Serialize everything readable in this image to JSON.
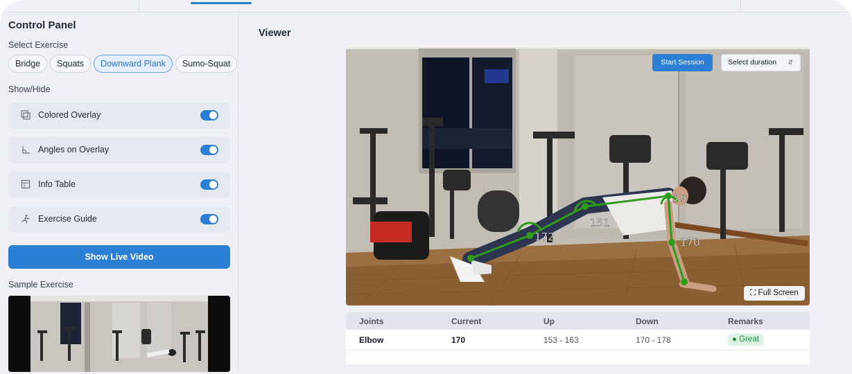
{
  "sidebar": {
    "title": "Control Panel",
    "select_exercise_label": "Select Exercise",
    "exercises": [
      "Bridge",
      "Squats",
      "Downward Plank",
      "Sumo-Squat"
    ],
    "active_exercise": "Downward Plank",
    "show_hide_label": "Show/Hide",
    "toggles": [
      {
        "label": "Colored Overlay",
        "icon": "overlay-icon",
        "on": true
      },
      {
        "label": "Angles on Overlay",
        "icon": "angle-icon",
        "on": true
      },
      {
        "label": "Info Table",
        "icon": "table-icon",
        "on": true
      },
      {
        "label": "Exercise Guide",
        "icon": "running-person-icon",
        "on": true
      }
    ],
    "live_button": "Show Live Video",
    "sample_label": "Sample Exercise"
  },
  "viewer": {
    "title": "Viewer",
    "start_button": "Start Session",
    "duration_placeholder": "Select duration",
    "fullscreen_button": "Full Screen",
    "angles": [
      "172",
      "151",
      "79",
      "170"
    ]
  },
  "table": {
    "headers": [
      "Joints",
      "Current",
      "Up",
      "Down",
      "Remarks"
    ],
    "rows": [
      {
        "joint": "Elbow",
        "current": "170",
        "up": "153 - 163",
        "down": "170 - 178",
        "remark": "Great"
      }
    ]
  },
  "colors": {
    "accent": "#2b7fd4",
    "pose_line": "#2e9b1c",
    "good": "#1c8f46"
  }
}
